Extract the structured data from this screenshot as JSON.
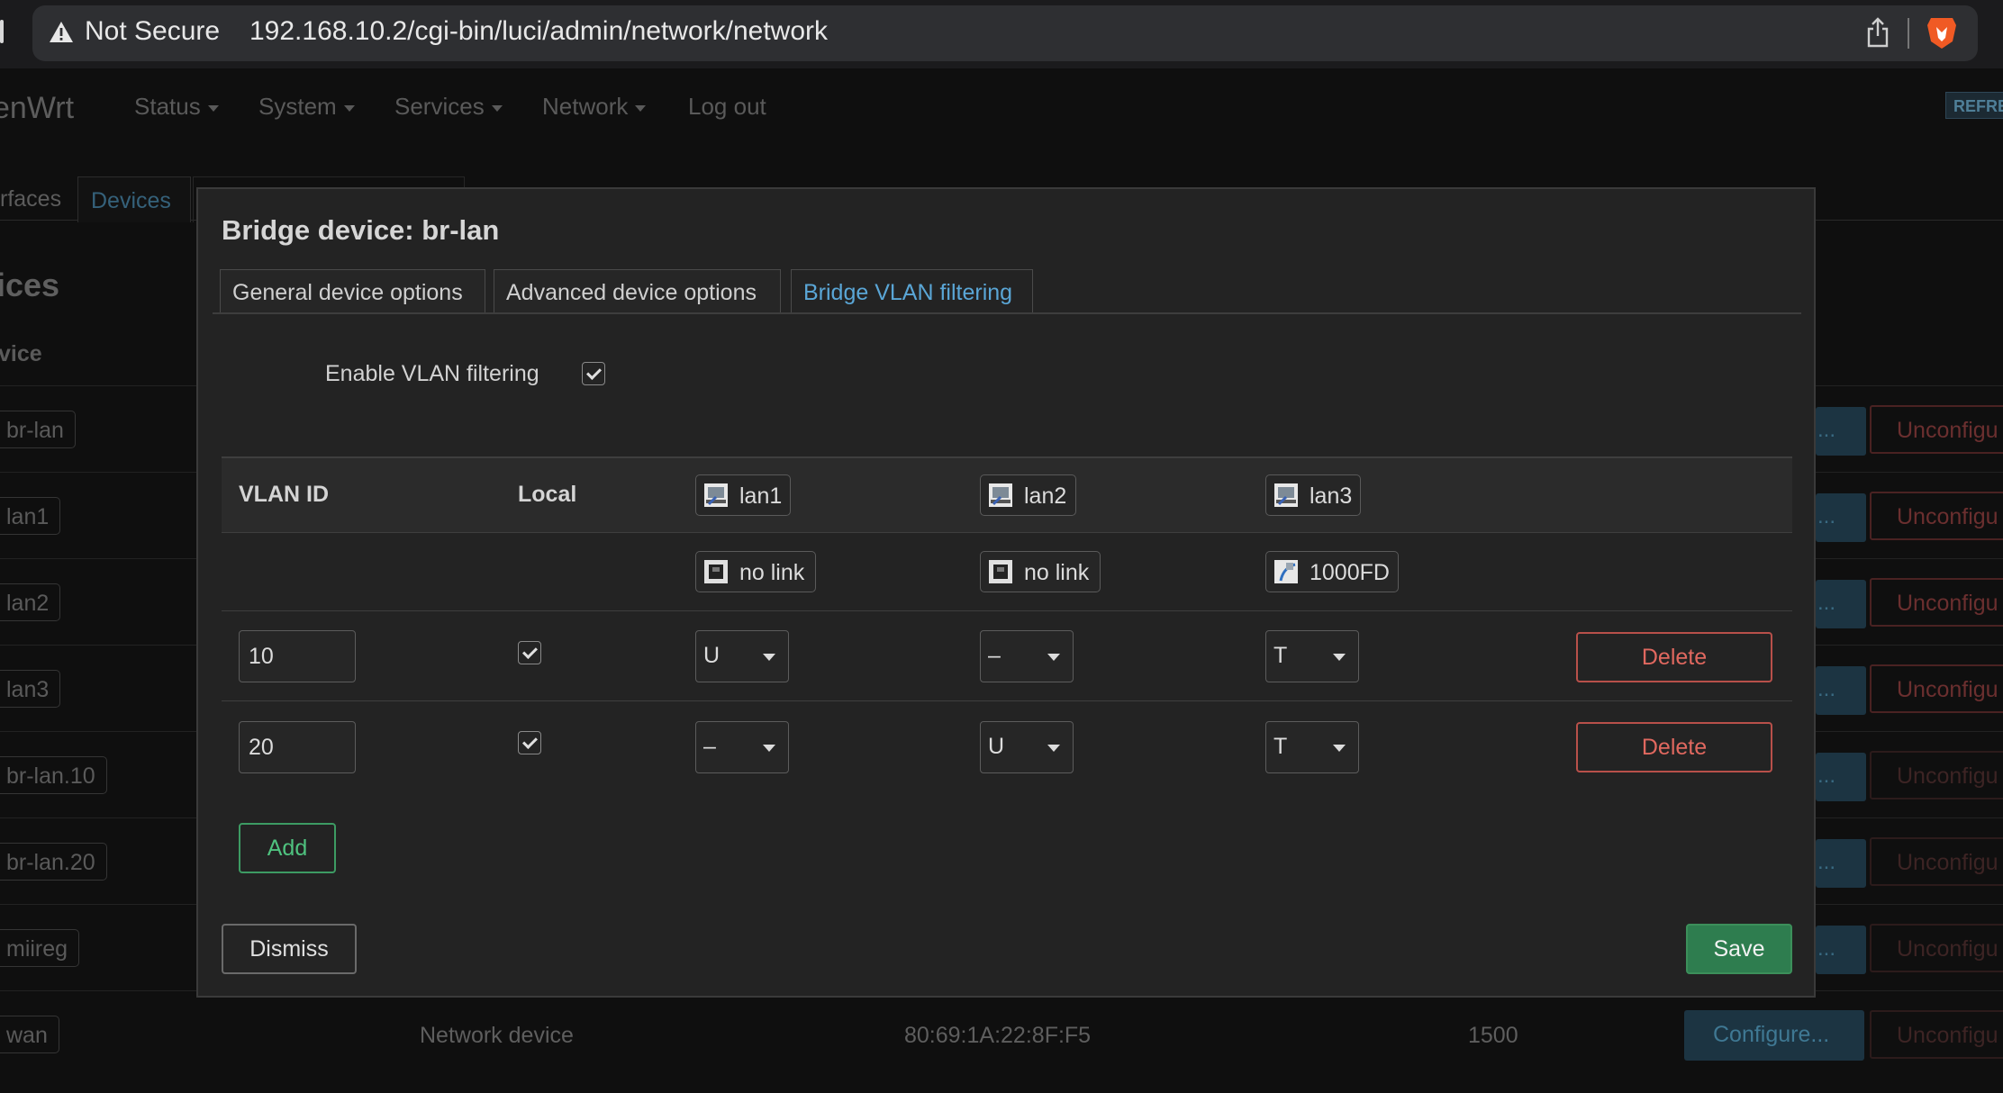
{
  "browser": {
    "security_label": "Not Secure",
    "url": "192.168.10.2/cgi-bin/luci/admin/network/network"
  },
  "nav": {
    "logo": "enWrt",
    "items": [
      "Status",
      "System",
      "Services",
      "Network",
      "Log out"
    ],
    "refresh_badge": "REFRE"
  },
  "background": {
    "tabs": [
      "rfaces",
      "Devices"
    ],
    "section_title": "ices",
    "column_header": "vice",
    "devices": [
      "br-lan",
      "lan1",
      "lan2",
      "lan3",
      "br-lan.10",
      "br-lan.20",
      "miireg",
      "wan"
    ],
    "configure_label": "...",
    "unconfigure_label": "Unconfigu",
    "wan_row": {
      "type": "Network device",
      "mac": "80:69:1A:22:8F:F5",
      "mtu": "1500",
      "configure": "Configure..."
    }
  },
  "modal": {
    "title": "Bridge device: br-lan",
    "tabs": [
      "General device options",
      "Advanced device options",
      "Bridge VLAN filtering"
    ],
    "active_tab": "Bridge VLAN filtering",
    "enable_vlan_label": "Enable VLAN filtering",
    "enable_vlan_checked": true,
    "table": {
      "headers": [
        "VLAN ID",
        "Local"
      ],
      "ports": [
        {
          "name": "lan1",
          "status": "no link"
        },
        {
          "name": "lan2",
          "status": "no link"
        },
        {
          "name": "lan3",
          "status": "1000FD"
        }
      ],
      "rows": [
        {
          "vlan_id": "10",
          "local": true,
          "lan1": "U",
          "lan2": "–",
          "lan3": "T"
        },
        {
          "vlan_id": "20",
          "local": true,
          "lan1": "–",
          "lan2": "U",
          "lan3": "T"
        }
      ],
      "delete_label": "Delete"
    },
    "add_label": "Add",
    "dismiss_label": "Dismiss",
    "save_label": "Save"
  },
  "colors": {
    "accent_blue": "#5aa6d6",
    "delete_red": "#e0685f",
    "add_green": "#4fc27f",
    "save_green": "#2e7d4f"
  }
}
